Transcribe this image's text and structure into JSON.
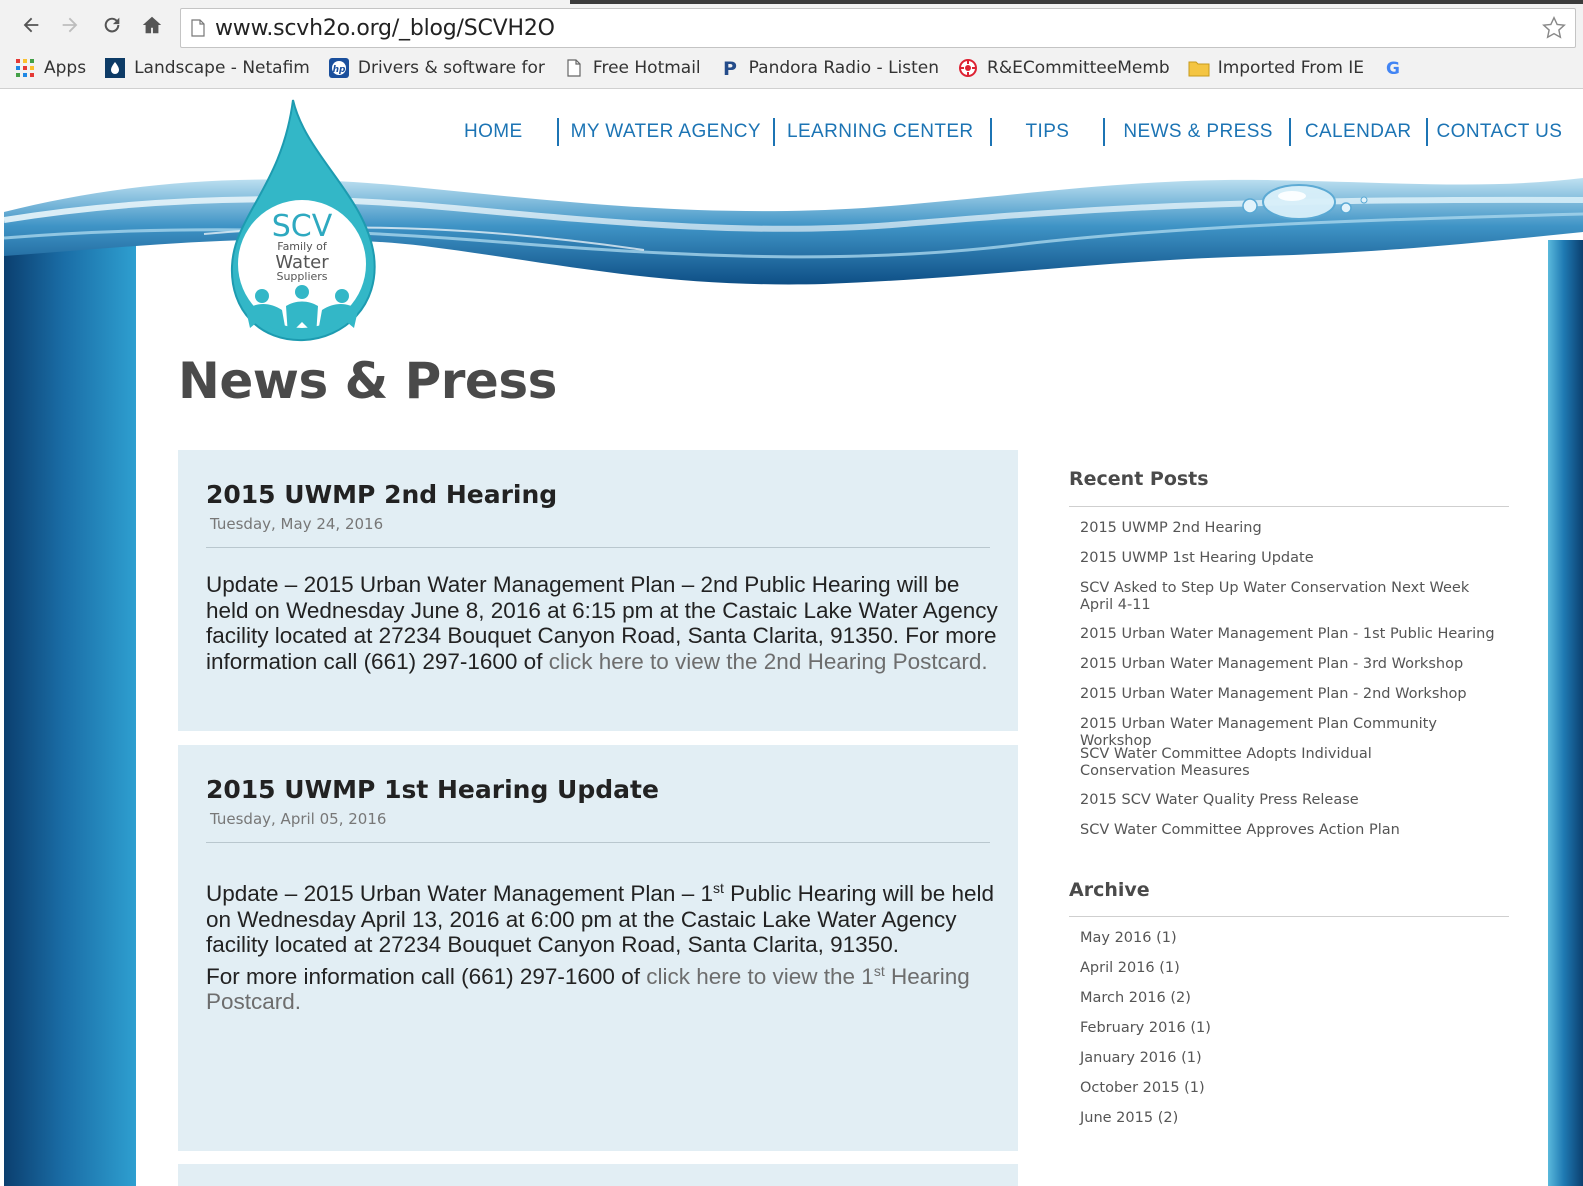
{
  "browser": {
    "url": "www.scvh2o.org/_blog/SCVH2O",
    "bookmarks": [
      {
        "icon": "apps-grid-icon",
        "label": "Apps"
      },
      {
        "icon": "netafim-icon",
        "label": "Landscape - Netafim"
      },
      {
        "icon": "hp-icon",
        "label": "Drivers & software for"
      },
      {
        "icon": "page-icon",
        "label": "Free Hotmail"
      },
      {
        "icon": "pandora-icon",
        "label": "Pandora Radio - Listen"
      },
      {
        "icon": "committee-icon",
        "label": "R&ECommitteeMemb"
      },
      {
        "icon": "folder-icon",
        "label": "Imported From IE"
      },
      {
        "icon": "google-icon",
        "label": ""
      }
    ]
  },
  "site": {
    "logo": {
      "line1": "SCV",
      "line2": "Family of",
      "line3": "Water",
      "line4": "Suppliers"
    },
    "nav": [
      "HOME",
      "MY WATER AGENCY",
      "LEARNING CENTER",
      "TIPS",
      "NEWS & PRESS",
      "CALENDAR",
      "CONTACT US"
    ],
    "page_title": "News & Press",
    "accent": "#1c74b4",
    "post_bg": "#e2eef4"
  },
  "posts": [
    {
      "title": "2015 UWMP 2nd Hearing",
      "date": "Tuesday, May 24, 2016",
      "body_1": "Update – 2015 Urban Water Management Plan – 2nd Public Hearing will be held on Wednesday June 8, 2016 at 6:15 pm at the Castaic Lake Water Agency facility located at 27234 Bouquet Canyon Road, Santa Clarita, 91350. For more information call (661) 297-1600 of ",
      "link_1": "click here to view the 2nd Hearing Postcard."
    },
    {
      "title": "2015 UWMP 1st Hearing Update",
      "date": "Tuesday, April 05, 2016",
      "body_pre": "Update – 2015 Urban Water Management Plan – 1",
      "body_sup": "st",
      "body_post": " Public Hearing will be held on Wednesday April 13, 2016 at 6:00 pm at the Castaic Lake Water Agency facility located at 27234 Bouquet Canyon Road, Santa Clarita, 91350.",
      "more_pre": "For more information call (661) 297-1600 of ",
      "link_pre": "click here to view the 1",
      "link_sup": "st",
      "link_post": " Hearing Postcard."
    }
  ],
  "sidebar": {
    "recent_heading": "Recent Posts",
    "recent": [
      "2015 UWMP 2nd Hearing",
      "2015 UWMP 1st Hearing Update",
      "SCV Asked to Step Up Water Conservation Next Week April 4-11",
      "2015 Urban Water Management Plan - 1st Public Hearing",
      "2015 Urban Water Management Plan - 3rd Workshop",
      "2015 Urban Water Management Plan - 2nd Workshop",
      "2015 Urban Water Management Plan Community Workshop",
      "SCV Water Committee Adopts Individual Conservation Measures",
      "2015 SCV Water Quality Press Release",
      "SCV Water Committee Approves Action Plan"
    ],
    "archive_heading": "Archive",
    "archive": [
      "May 2016 (1)",
      "April 2016 (1)",
      "March 2016 (2)",
      "February 2016 (1)",
      "January 2016 (1)",
      "October 2015 (1)",
      "June 2015 (2)"
    ]
  }
}
